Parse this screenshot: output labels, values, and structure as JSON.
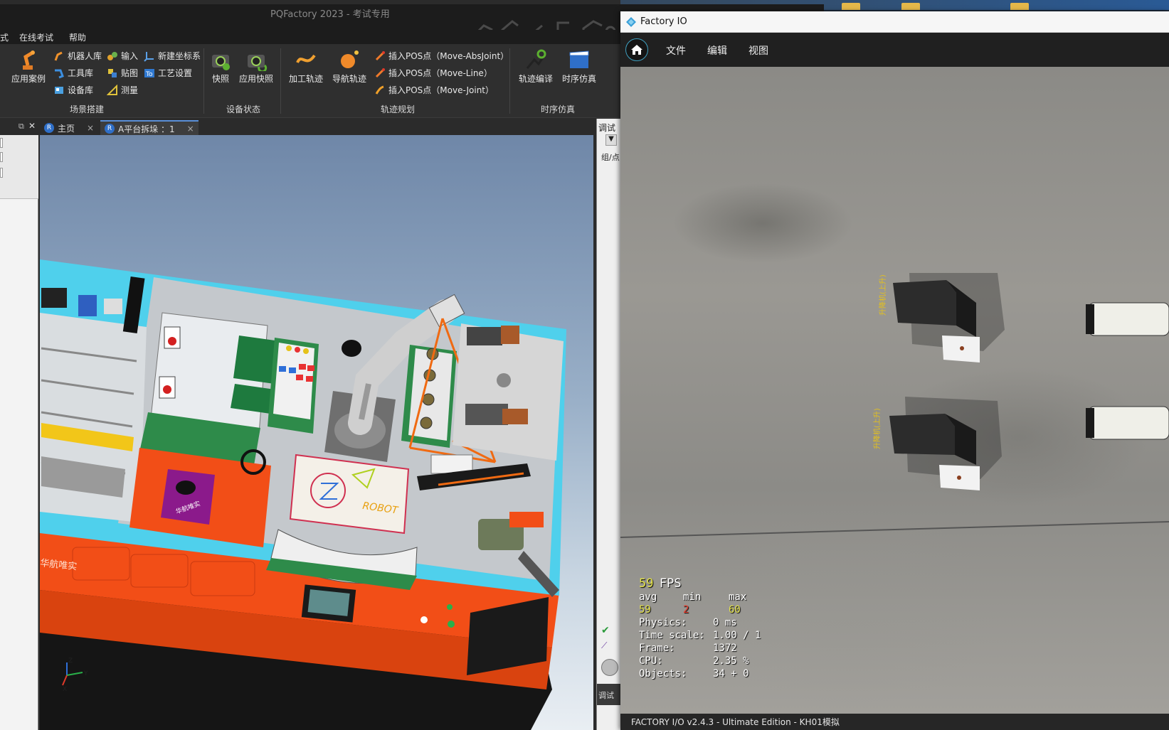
{
  "pqfactory": {
    "title": "PQFactory 2023 - 考试专用",
    "menu": [
      "式",
      "在线考试",
      "帮助"
    ],
    "ribbon": {
      "scene_build": {
        "group": "场景搭建",
        "big": "应用案例",
        "items": [
          "机器人库",
          "工具库",
          "设备库",
          "输入",
          "贴图",
          "测量",
          "新建坐标系",
          "工艺设置"
        ]
      },
      "device_state": {
        "group": "设备状态",
        "items": [
          "快照",
          "应用快照"
        ]
      },
      "trajectory": {
        "group": "轨迹规划",
        "big": [
          "加工轨迹",
          "导航轨迹"
        ],
        "items": [
          "插入POS点（Move-AbsJoint）",
          "插入POS点（Move-Line）",
          "插入POS点（Move-Joint）"
        ]
      },
      "timing": {
        "group": "时序仿真",
        "items": [
          "轨迹编译",
          "时序仿真"
        ]
      }
    },
    "tabs": [
      {
        "label": "主页",
        "close": "×"
      },
      {
        "label": "A平台拆垛 ：1",
        "close": "×"
      }
    ],
    "right_panel": {
      "top": "调试",
      "row": "组/点",
      "bottom": "调试"
    },
    "scene_text": {
      "brand": "华航唯实",
      "mat_text": "华航唯实",
      "robot_text": "ROBOT"
    },
    "axes": {
      "z": "Z",
      "y": "Y",
      "x": "X"
    },
    "colors": {
      "platform": "#f4511e",
      "frame": "#4fd0ec",
      "board": "#2e8b4a"
    }
  },
  "factoryio": {
    "title": "Factory IO",
    "menu": [
      "文件",
      "编辑",
      "视图"
    ],
    "stats": {
      "fps": "59",
      "fps_unit": "FPS",
      "avg_label": "avg",
      "min_label": "min",
      "max_label": "max",
      "avg": "59",
      "min": "2",
      "max": "60",
      "physics_label": "Physics:",
      "physics": "0 ms",
      "timescale_label": "Time scale:",
      "timescale": "1.00 / 1",
      "frame_label": "Frame:",
      "frame": "1372",
      "cpu_label": "CPU:",
      "cpu": "2.35 %",
      "objects_label": "Objects:",
      "objects": "34 + 0"
    },
    "status": "FACTORY I/O v2.4.3 - Ultimate Edition - KH01模拟",
    "machine_label": "升降机(上升)"
  }
}
